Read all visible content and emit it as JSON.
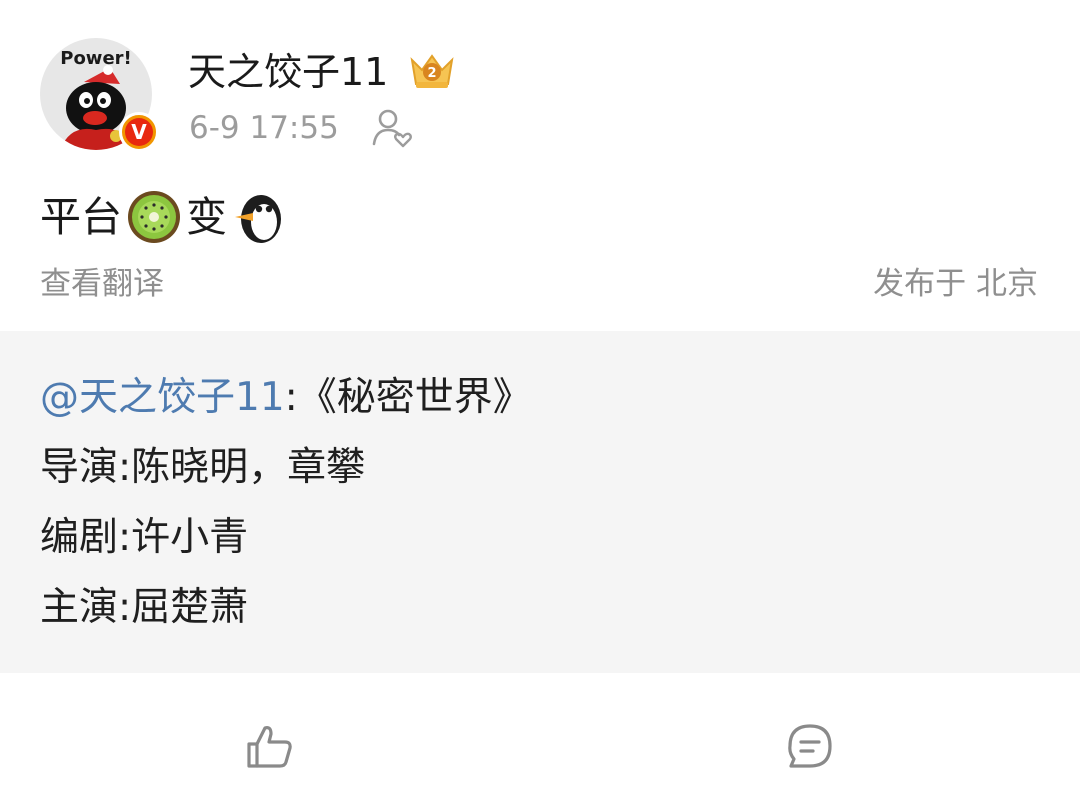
{
  "author": {
    "avatar_text": "Power!",
    "verified_mark": "V",
    "name": "天之饺子11",
    "crown_level": "2",
    "timestamp": "6-9 17:55"
  },
  "post": {
    "text_part1": "平台",
    "text_part2": "变",
    "emoji1": "kiwi-emoji",
    "emoji2": "penguin-emoji",
    "translate_label": "查看翻译",
    "location": "发布于 北京"
  },
  "repost": {
    "mention": "@天之饺子11",
    "title": ":《秘密世界》",
    "lines": [
      "导演:陈晓明，章攀",
      "编剧:许小青",
      "主演:屈楚萧"
    ]
  },
  "actions": {
    "like_icon": "thumbs-up-icon",
    "comment_icon": "comment-icon"
  },
  "colors": {
    "mention": "#4e7bb0",
    "meta": "#9c9c9c",
    "repost_bg": "#f5f5f5",
    "badge_red": "#e8290f",
    "badge_orange": "#f19600"
  }
}
